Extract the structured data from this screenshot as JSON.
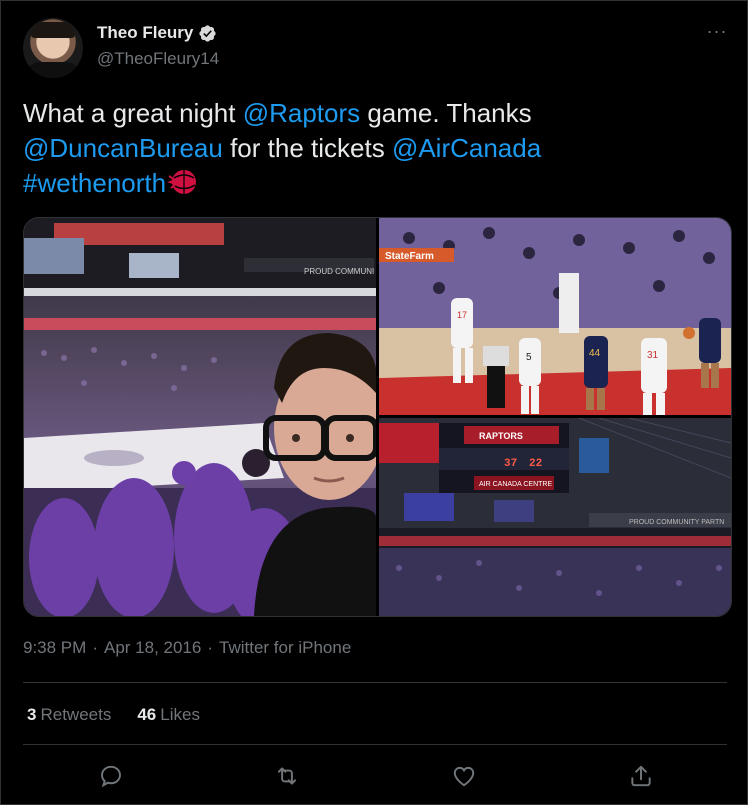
{
  "tweet": {
    "display_name": "Theo Fleury",
    "handle": "@TheoFleury14",
    "more_label": "···",
    "text_parts": {
      "p1": "What a great night ",
      "mention_raptors": "@Raptors",
      "p2": " game. Thanks",
      "mention_duncan": "@DuncanBureau",
      "p3": " for the tickets ",
      "mention_aircanada": "@AirCanada",
      "hashtag": "#wethenorth"
    },
    "time": "9:38 PM",
    "date": "Apr 18, 2016",
    "source": "Twitter for iPhone",
    "separator": "·",
    "stats": {
      "retweets_count": "3",
      "retweets_label": "Retweets",
      "likes_count": "46",
      "likes_label": "Likes"
    }
  },
  "photos": {
    "left_banner": "PROUD COMMUNI",
    "tr_sign": "StateFarm",
    "tr_jersey_a": "17",
    "tr_jersey_b": "5",
    "tr_jersey_c": "44",
    "tr_jersey_d": "31",
    "br_board_title": "RAPTORS",
    "br_board_sub": "AIR CANADA CENTRE",
    "br_score_a": "37",
    "br_score_b": "22",
    "br_banner": "PROUD COMMUNITY PARTN"
  },
  "icons": {
    "verified": "verified-badge-icon",
    "reply": "reply-icon",
    "retweet": "retweet-icon",
    "like": "heart-icon",
    "share": "share-icon"
  },
  "colors": {
    "background": "#000000",
    "link": "#1d9bf0",
    "text": "#e7e9ea",
    "muted": "#71767b",
    "border": "#2f3336"
  }
}
